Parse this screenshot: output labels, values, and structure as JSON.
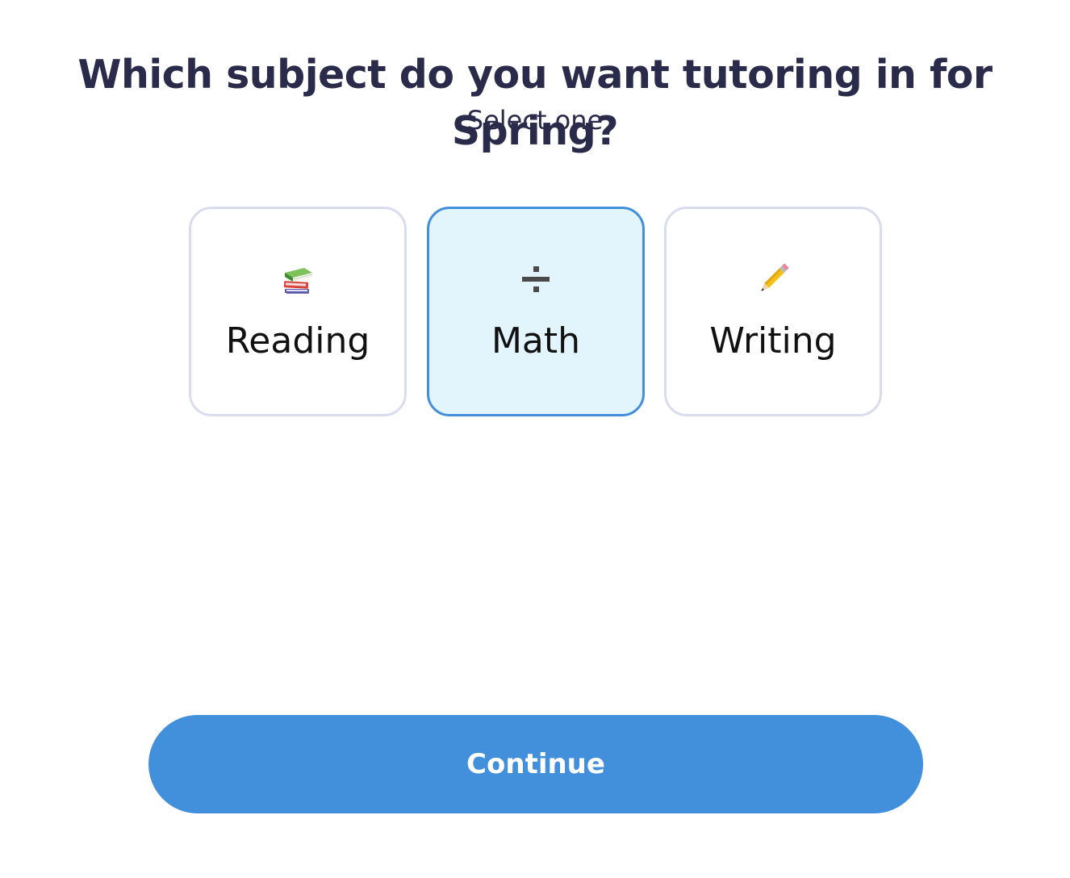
{
  "question": {
    "title": "Which subject do you want tutoring in for Spring?",
    "subtitle": "Select one"
  },
  "options": [
    {
      "label": "Reading",
      "icon": "books-icon",
      "selected": false
    },
    {
      "label": "Math",
      "icon": "division-sign-icon",
      "selected": true
    },
    {
      "label": "Writing",
      "icon": "pencil-icon",
      "selected": false
    }
  ],
  "actions": {
    "continue_label": "Continue"
  },
  "colors": {
    "accent": "#428fdc",
    "selected_background": "#e3f5fc",
    "card_border": "#d9dcef",
    "heading_text": "#2a2a4a"
  }
}
